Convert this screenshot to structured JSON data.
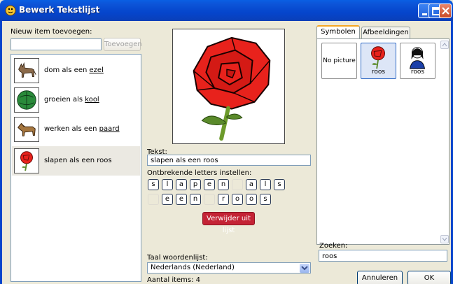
{
  "window": {
    "title": "Bewerk Tekstlijst"
  },
  "left": {
    "new_item_label": "Nieuw item toevoegen:",
    "new_item_value": "",
    "add_button": "Toevoegen",
    "items": [
      {
        "prefix": "dom als een ",
        "keyword": "ezel",
        "image": "donkey"
      },
      {
        "prefix": "groeien als ",
        "keyword": "kool",
        "image": "cabbage"
      },
      {
        "prefix": "werken als een ",
        "keyword": "paard",
        "image": "horse"
      },
      {
        "prefix": "slapen als een roos",
        "keyword": "",
        "image": "rose",
        "selected": true
      }
    ]
  },
  "center": {
    "text_label": "Tekst:",
    "text_value": "slapen als een roos",
    "missing_label": "Ontbrekende letters instellen:",
    "row1": [
      "s",
      "l",
      "a",
      "p",
      "e",
      "n",
      "",
      "a",
      "l",
      "s"
    ],
    "row2": [
      "",
      "e",
      "e",
      "n",
      "",
      "r",
      "o",
      "o",
      "s"
    ],
    "remove_button": "Verwijder uit lijst",
    "language_label": "Taal woordenlijst:",
    "language_value": "Nederlands (Nederland)",
    "item_count": "Aantal items: 4"
  },
  "right": {
    "tabs": [
      "Symbolen",
      "Afbeeldingen"
    ],
    "active_tab": "Symbolen",
    "symbols": [
      {
        "label": "No picture",
        "image": "none"
      },
      {
        "label": "roos",
        "image": "rose",
        "selected": true
      },
      {
        "label": "roos",
        "image": "person"
      }
    ],
    "search_label": "Zoeken:",
    "search_value": "roos",
    "cancel_button": "Annuleren",
    "ok_button": "OK"
  },
  "colors": {
    "titlebar": "#0545cc",
    "remove_button": "#c42335",
    "rose_red": "#e8221c",
    "stem_green": "#5a8a2a"
  }
}
